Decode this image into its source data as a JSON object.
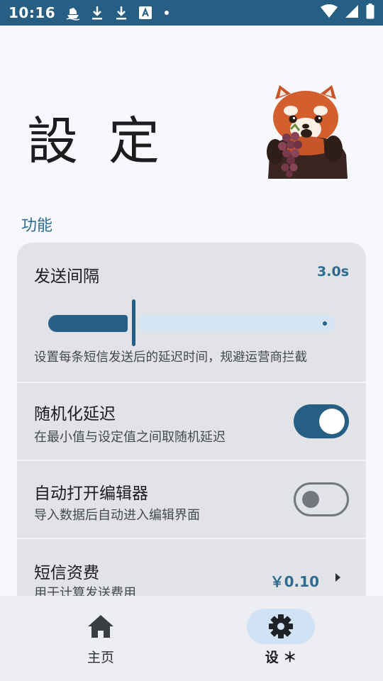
{
  "status_bar": {
    "time": "10:16",
    "icons": [
      "ship-icon",
      "download-icon",
      "download-icon",
      "a-text-icon",
      "dot-icon"
    ],
    "right_icons": [
      "wifi-icon",
      "signal-icon",
      "battery-icon"
    ]
  },
  "header": {
    "title": "設 定"
  },
  "section": {
    "label": "功能"
  },
  "settings": {
    "send_interval": {
      "title": "发送间隔",
      "value": "3.0s",
      "slider_fraction": 0.28,
      "description": "设置每条短信发送后的延迟时间，规避运营商拦截"
    },
    "random_delay": {
      "title": "随机化延迟",
      "description": "在最小值与设定值之间取随机延迟",
      "enabled": true
    },
    "auto_editor": {
      "title": "自动打开编辑器",
      "description": "导入数据后自动进入编辑界面",
      "enabled": false
    },
    "sms_fee": {
      "title": "短信资费",
      "description": "用于计算发送费用",
      "value": "￥0.10"
    }
  },
  "bottom_nav": {
    "items": [
      {
        "label": "主页",
        "icon": "home-icon",
        "active": false
      },
      {
        "label": "设 ＊",
        "icon": "gear-icon",
        "active": true
      }
    ]
  },
  "colors": {
    "accent": "#275e84",
    "accent_light": "#d3e4f5",
    "section_label": "#2f6b8e",
    "card_bg": "#e1e3e7"
  }
}
